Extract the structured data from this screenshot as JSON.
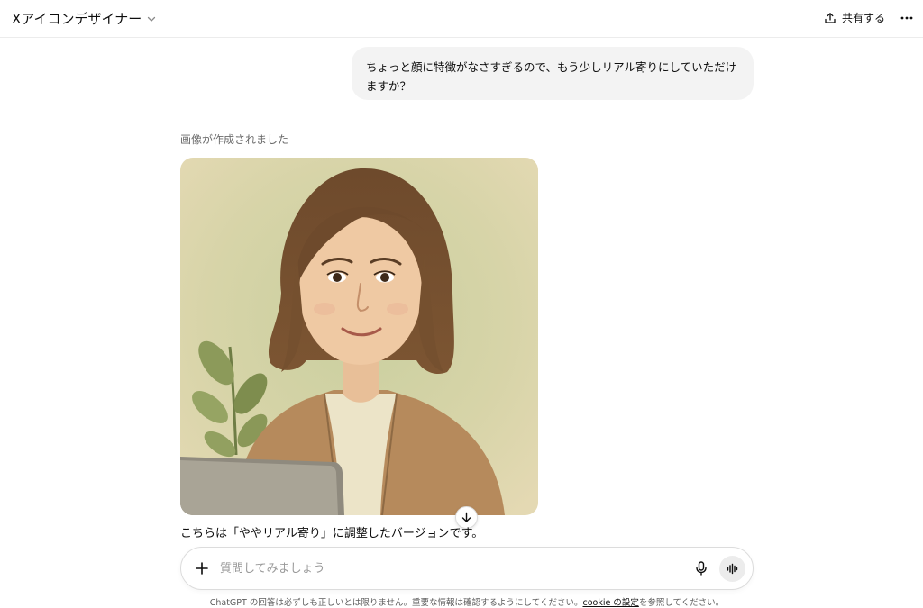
{
  "header": {
    "title": "Xアイコンデザイナー",
    "share_label": "共有する"
  },
  "conversation": {
    "user_message": "ちょっと顔に特徴がなさすぎるので、もう少しリアル寄りにしていただけますか？",
    "image_status": "画像が作成されました",
    "assistant_reply": "こちらは「ややリアル寄り」に調整したバージョンです。"
  },
  "composer": {
    "placeholder": "質問してみましょう"
  },
  "footer": {
    "disclaimer_before": "ChatGPT の回答は必ずしも正しいとは限りません。重要な情報は確認するようにしてください。",
    "cookie_link": "cookie の設定",
    "disclaimer_after": "を参照してください。"
  },
  "icons": {
    "model_switch": "chevron-down-icon",
    "share": "share-upload-icon",
    "more": "more-horizontal-icon",
    "scroll": "arrow-down-icon",
    "attach": "plus-icon",
    "mic": "microphone-icon",
    "voice": "voice-mode-icon"
  },
  "colors": {
    "page_bg": "#ffffff",
    "user_bubble_bg": "#f3f3f3",
    "muted_text": "#6b6b6b",
    "voice_button_bg": "#ececec"
  }
}
